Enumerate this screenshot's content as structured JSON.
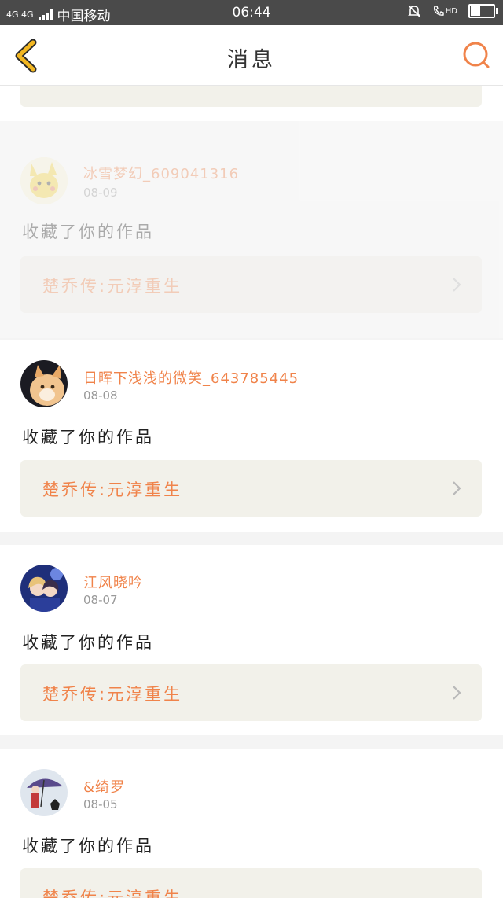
{
  "status_bar": {
    "network": "4G 4G",
    "carrier": "中国移动",
    "time": "06:44",
    "hd_label": "HD",
    "battery_level": 0.45
  },
  "nav": {
    "title": "消息",
    "back_icon": "chevron-left-icon",
    "search_icon": "search-icon"
  },
  "colors": {
    "accent": "#f0834a",
    "back_icon": "#f2b722",
    "work_bg": "#f2f1ea"
  },
  "messages": [
    {
      "username": "冰雪梦幻_609041316",
      "date": "08-09",
      "action": "收藏了你的作品",
      "work_title": "楚乔传:元淳重生"
    },
    {
      "username": "日晖下浅浅的微笑_643785445",
      "date": "08-08",
      "action": "收藏了你的作品",
      "work_title": "楚乔传:元淳重生"
    },
    {
      "username": "江风晓吟",
      "date": "08-07",
      "action": "收藏了你的作品",
      "work_title": "楚乔传:元淳重生"
    },
    {
      "username": "&绮罗",
      "date": "08-05",
      "action": "收藏了你的作品",
      "work_title": "楚乔传:元淳重生"
    }
  ]
}
